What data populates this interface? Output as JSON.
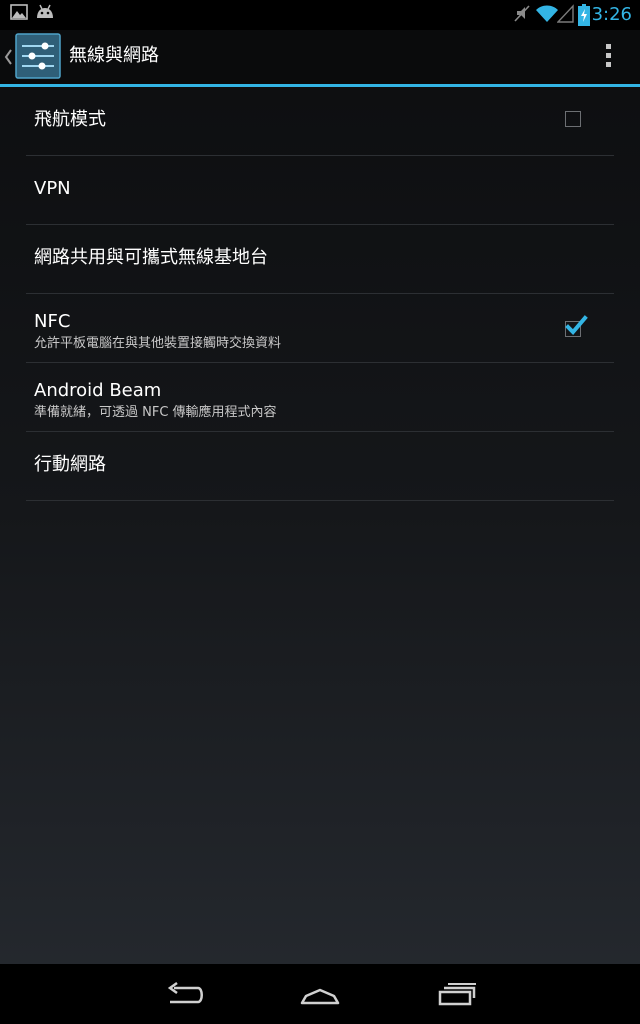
{
  "status_bar": {
    "time": "3:26",
    "icons": [
      "image-notification-icon",
      "android-notification-icon",
      "mute-icon",
      "wifi-icon",
      "signal-icon",
      "battery-charging-icon"
    ],
    "accent_color": "#33b5e5"
  },
  "action_bar": {
    "title": "無線與網路",
    "icon": "settings-sliders-icon",
    "accent_color": "#33b5e5"
  },
  "settings": {
    "items": [
      {
        "title": "飛航模式",
        "checkbox": false
      },
      {
        "title": "VPN"
      },
      {
        "title": "網路共用與可攜式無線基地台"
      },
      {
        "title": "NFC",
        "summary": "允許平板電腦在與其他裝置接觸時交換資料",
        "checkbox": true
      },
      {
        "title": "Android Beam",
        "summary": "準備就緒，可透過 NFC 傳輸應用程式內容"
      },
      {
        "title": "行動網路"
      }
    ]
  },
  "nav_bar": {
    "buttons": [
      "back-icon",
      "home-icon",
      "recents-icon"
    ]
  }
}
